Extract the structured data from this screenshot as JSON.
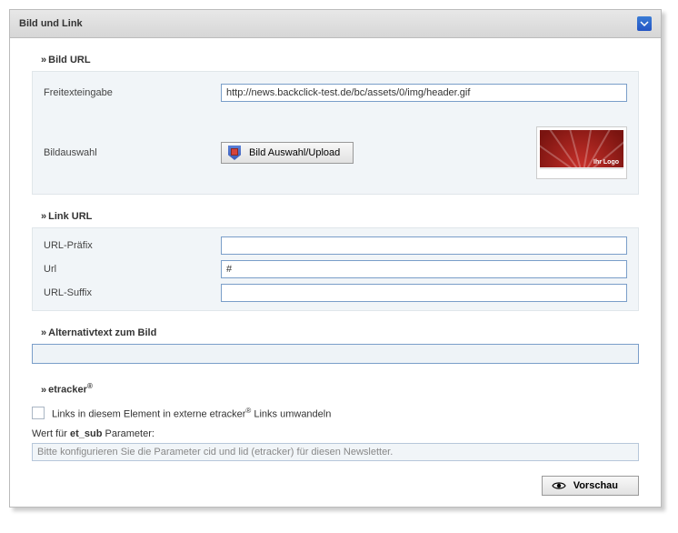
{
  "header": {
    "title": "Bild und Link"
  },
  "bild": {
    "section_title": "Bild URL",
    "freitext_label": "Freitexteingabe",
    "freitext_value": "http://news.backclick-test.de/bc/assets/0/img/header.gif",
    "auswahl_label": "Bildauswahl",
    "auswahl_button": "Bild Auswahl/Upload",
    "thumb_logo": "Ihr Logo"
  },
  "link": {
    "section_title": "Link URL",
    "prefix_label": "URL-Präfix",
    "prefix_value": "",
    "url_label": "Url",
    "url_value": "#",
    "suffix_label": "URL-Suffix",
    "suffix_value": ""
  },
  "alt": {
    "section_title": "Alternativtext zum Bild",
    "value": ""
  },
  "etracker": {
    "section_title_prefix": "etracker",
    "checkbox_label_a": "Links in diesem Element in externe etracker",
    "checkbox_label_b": " Links umwandeln",
    "param_label_a": "Wert für ",
    "param_label_b": "et_sub",
    "param_label_c": " Parameter:",
    "param_placeholder": "Bitte konfigurieren Sie die Parameter cid und lid (etracker) für diesen Newsletter."
  },
  "footer": {
    "preview_button": "Vorschau"
  }
}
